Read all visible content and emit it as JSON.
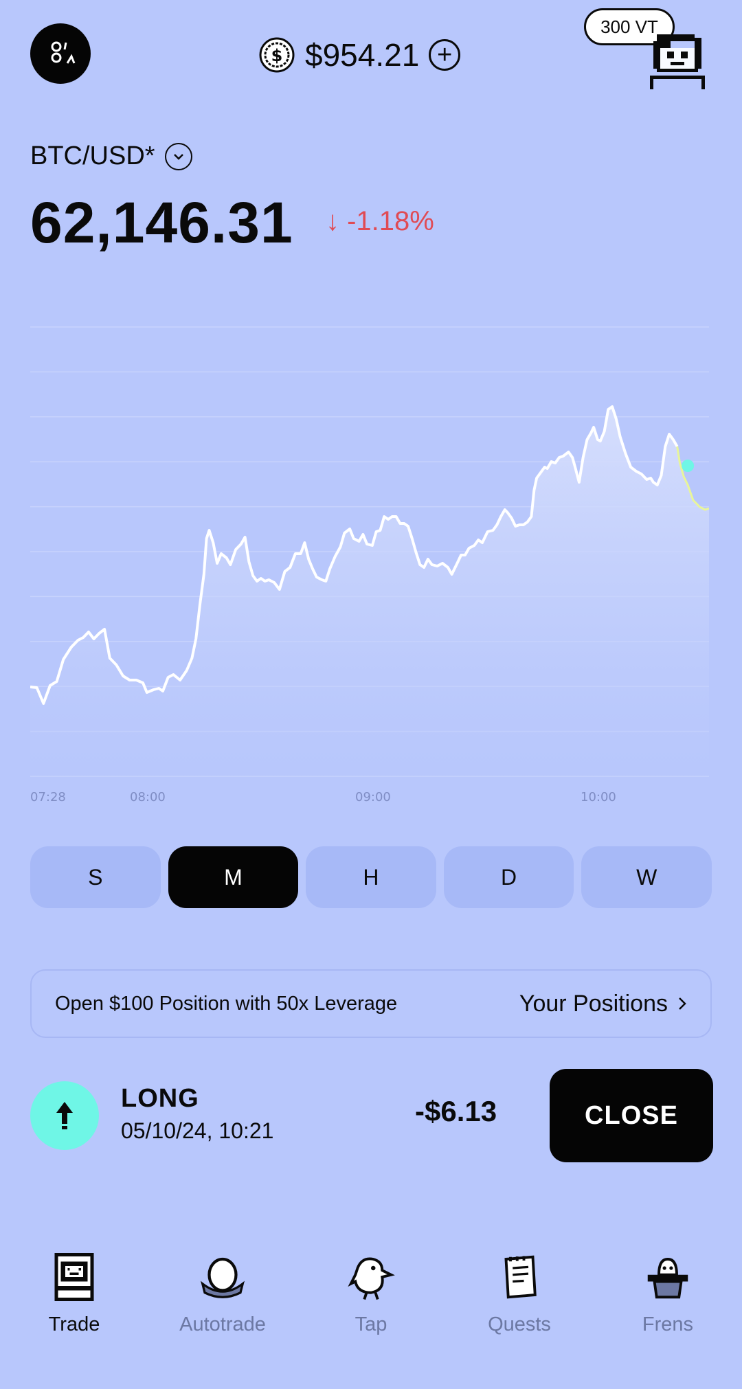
{
  "header": {
    "logo_icon": "vooi-logo-icon",
    "balance": "$954.21",
    "balance_icon": "dollar-coin-icon",
    "add_icon": "plus-circle-icon",
    "vt_badge": "300 VT",
    "avatar_icon": "pixel-avatar-icon"
  },
  "market": {
    "pair": "BTC/USD*",
    "price": "62,146.31",
    "change": "↓ -1.18%",
    "change_color": "#e04b54"
  },
  "chart_data": {
    "type": "line",
    "x_ticks": [
      "07:28",
      "08:00",
      "09:00",
      "10:00"
    ],
    "grid": true,
    "line_color": "#ffffff",
    "marker_color": "#6ff6e6",
    "tail_color": "#e8f59a"
  },
  "timeframes": {
    "items": [
      "S",
      "M",
      "H",
      "D",
      "W"
    ],
    "selected": "M"
  },
  "positions_bar": {
    "text": "Open $100 Position with 50x Leverage",
    "link": "Your Positions"
  },
  "position": {
    "side": "LONG",
    "date": "05/10/24, 10:21",
    "pnl": "-$6.13",
    "close_label": "CLOSE"
  },
  "nav": {
    "items": [
      {
        "label": "Trade",
        "icon": "arcade-icon"
      },
      {
        "label": "Autotrade",
        "icon": "nest-icon"
      },
      {
        "label": "Tap",
        "icon": "bird-icon"
      },
      {
        "label": "Quests",
        "icon": "notepad-icon"
      },
      {
        "label": "Frens",
        "icon": "magic-hat-icon"
      }
    ],
    "active": "Trade"
  }
}
